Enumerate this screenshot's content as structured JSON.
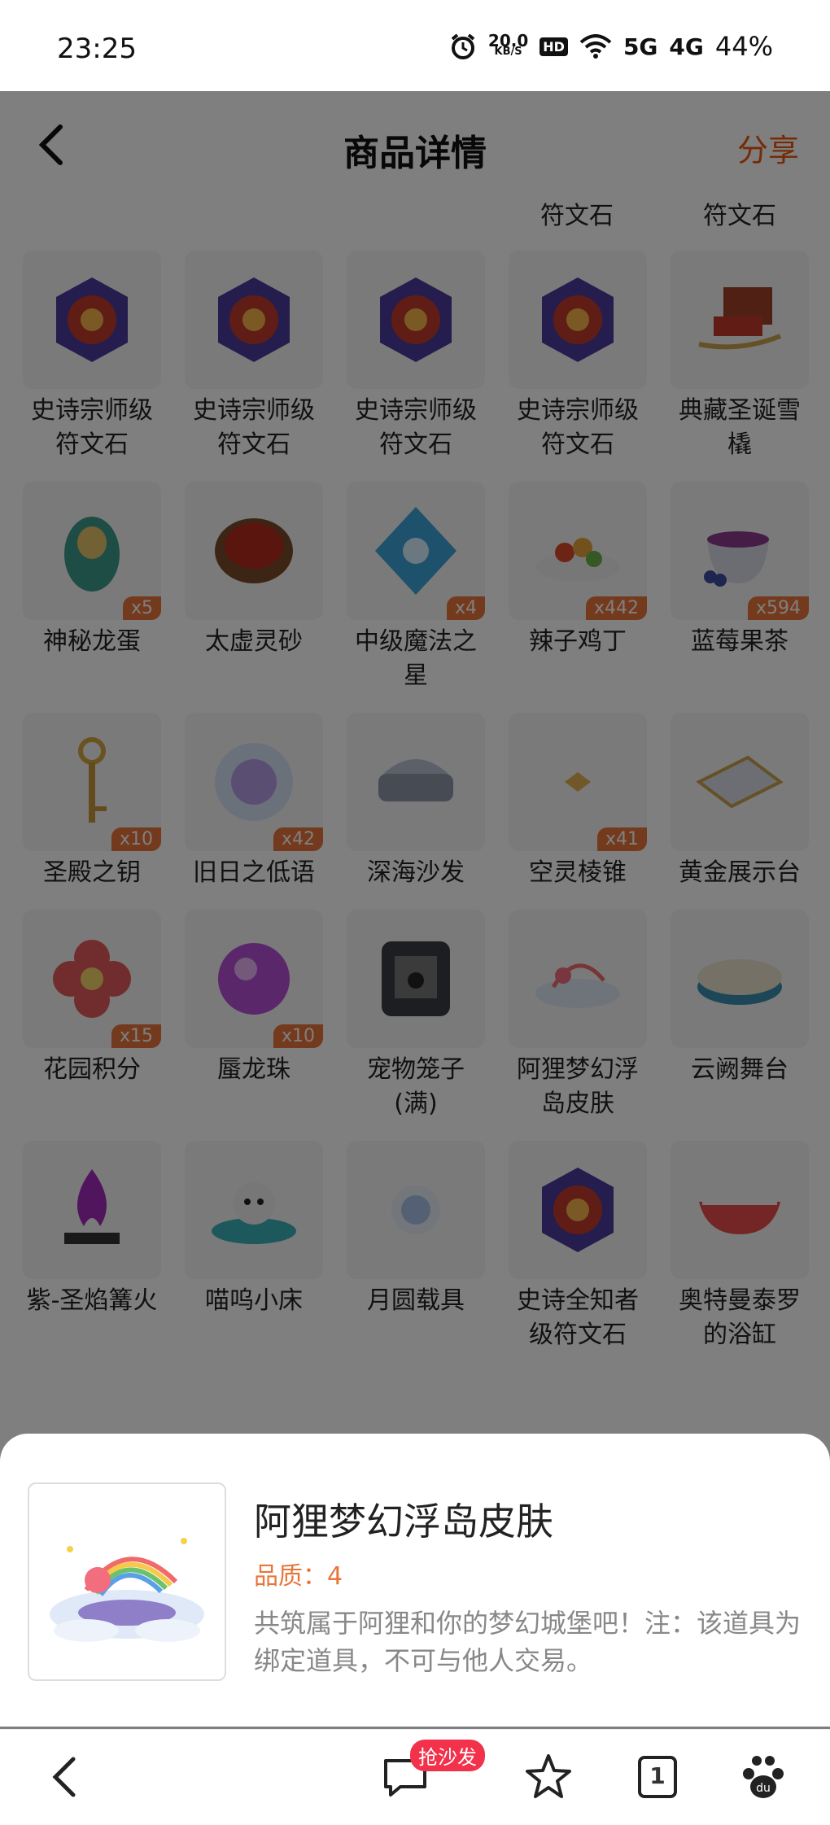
{
  "status_bar": {
    "time": "23:25",
    "net_speed_value": "20.0",
    "net_speed_unit": "KB/S",
    "hd": "HD",
    "sig5g": "5G",
    "sig4g": "4G",
    "battery": "44%"
  },
  "nav": {
    "title": "商品详情",
    "share": "分享"
  },
  "top_names": [
    "符文石",
    "符文石"
  ],
  "items": [
    {
      "name": "史诗宗师级符文石",
      "qty": "",
      "icon": "rune-stone-icon"
    },
    {
      "name": "史诗宗师级符文石",
      "qty": "",
      "icon": "rune-stone-icon"
    },
    {
      "name": "史诗宗师级符文石",
      "qty": "",
      "icon": "rune-stone-icon"
    },
    {
      "name": "史诗宗师级符文石",
      "qty": "",
      "icon": "rune-stone-icon"
    },
    {
      "name": "典藏圣诞雪橇",
      "qty": "",
      "icon": "sleigh-icon"
    },
    {
      "name": "神秘龙蛋",
      "qty": "x5",
      "icon": "dragon-egg-icon"
    },
    {
      "name": "太虚灵砂",
      "qty": "",
      "icon": "bowl-icon"
    },
    {
      "name": "中级魔法之星",
      "qty": "x4",
      "icon": "magic-star-icon"
    },
    {
      "name": "辣子鸡丁",
      "qty": "x442",
      "icon": "food-plate-icon"
    },
    {
      "name": "蓝莓果茶",
      "qty": "x594",
      "icon": "tea-cup-icon"
    },
    {
      "name": "圣殿之钥",
      "qty": "x10",
      "icon": "key-icon"
    },
    {
      "name": "旧日之低语",
      "qty": "x42",
      "icon": "orb-icon"
    },
    {
      "name": "深海沙发",
      "qty": "",
      "icon": "sofa-icon"
    },
    {
      "name": "空灵棱锥",
      "qty": "x41",
      "icon": "pyramid-icon"
    },
    {
      "name": "黄金展示台",
      "qty": "",
      "icon": "display-stand-icon"
    },
    {
      "name": "花园积分",
      "qty": "x15",
      "icon": "flower-icon"
    },
    {
      "name": "蜃龙珠",
      "qty": "x10",
      "icon": "purple-pearl-icon"
    },
    {
      "name": "宠物笼子(满)",
      "qty": "",
      "icon": "pet-cage-icon"
    },
    {
      "name": "阿狸梦幻浮岛皮肤",
      "qty": "",
      "icon": "floating-island-icon"
    },
    {
      "name": "云阙舞台",
      "qty": "",
      "icon": "stage-icon"
    },
    {
      "name": "紫-圣焰篝火",
      "qty": "",
      "icon": "bonfire-icon"
    },
    {
      "name": "喵呜小床",
      "qty": "",
      "icon": "cat-bed-icon"
    },
    {
      "name": "月圆载具",
      "qty": "",
      "icon": "moon-vehicle-icon"
    },
    {
      "name": "史诗全知者级符文石",
      "qty": "",
      "icon": "rune-stone-icon"
    },
    {
      "name": "奥特曼泰罗的浴缸",
      "qty": "",
      "icon": "bathtub-icon"
    }
  ],
  "sheet": {
    "name": "阿狸梦幻浮岛皮肤",
    "quality": "品质：4",
    "description": "共筑属于阿狸和你的梦幻城堡吧！注：该道具为绑定道具，不可与他人交易。"
  },
  "toolbar": {
    "badge": "抢沙发",
    "tabs_count": "1"
  },
  "colors": {
    "accent": "#e8753a",
    "share": "#e8580e",
    "badge": "#f2324a",
    "overlay": "rgba(0,0,0,0.5)"
  }
}
